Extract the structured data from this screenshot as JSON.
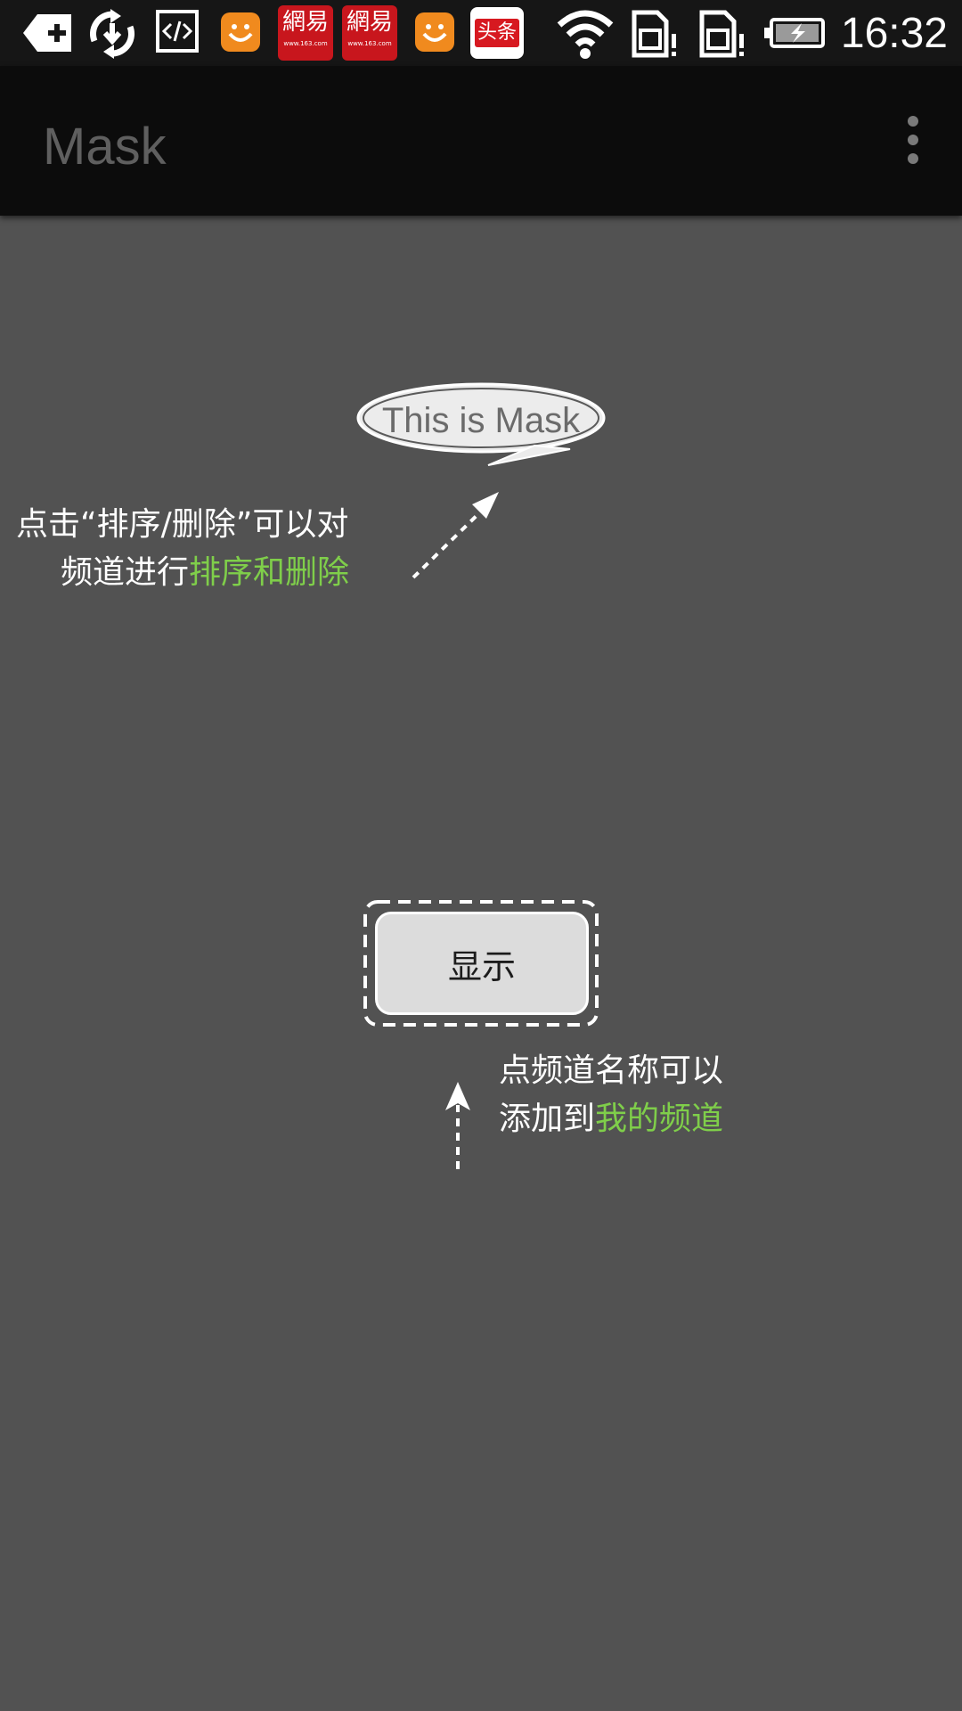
{
  "status_bar": {
    "time": "16:32",
    "icons": [
      "add-icon",
      "sync-icon",
      "code-icon",
      "smiley-app-icon",
      "netease-app-icon",
      "netease-app-icon",
      "smiley-app-icon",
      "toutiao-app-icon",
      "wifi-icon",
      "sim-alert-icon",
      "sim-alert-icon",
      "battery-charging-icon"
    ],
    "netease_label": "網易",
    "netease_sub": "www.163.com",
    "toutiao_label": "头条"
  },
  "action_bar": {
    "title": "Mask",
    "overflow_icon": "overflow-menu-icon"
  },
  "content": {
    "bubble_text": "This is Mask",
    "sort_hint": {
      "line1": "点击“排序/删除”可以对",
      "line2_prefix": "频道进行",
      "line2_highlight": "排序和删除"
    },
    "show_button_label": "显示",
    "add_hint": {
      "line1": "点频道名称可以",
      "line2_prefix": "添加到",
      "line2_highlight": "我的频道"
    }
  },
  "colors": {
    "background": "#525252",
    "action_bar": "#0c0c0c",
    "highlight": "#7fce4a",
    "netease_red": "#c8161d",
    "smiley_orange": "#f08a1e"
  }
}
